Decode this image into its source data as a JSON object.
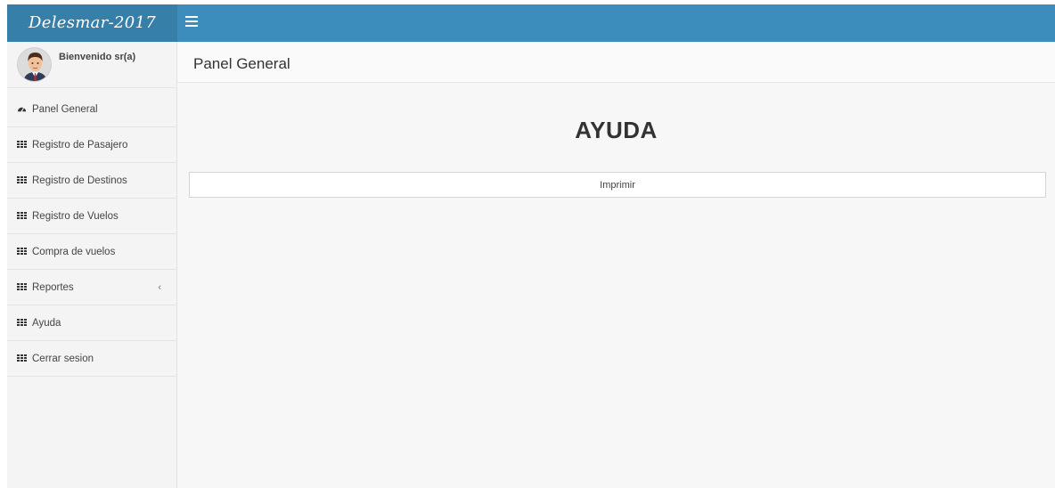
{
  "app": {
    "logo_text": "Delesmar-2017"
  },
  "colors": {
    "logo_bg": "#367fa9",
    "topbar_bg": "#3c8dbc",
    "sidebar_bg": "#f4f4f4",
    "content_bg": "#f7f7f7"
  },
  "user": {
    "greeting": "Bienvenido sr(a)",
    "avatar_icon": "user-avatar-icon"
  },
  "sidebar": {
    "items": [
      {
        "label": "Panel General",
        "icon": "dashboard-icon"
      },
      {
        "label": "Registro de Pasajero",
        "icon": "table-icon"
      },
      {
        "label": "Registro de Destinos",
        "icon": "table-icon"
      },
      {
        "label": "Registro de Vuelos",
        "icon": "table-icon"
      },
      {
        "label": "Compra de vuelos",
        "icon": "table-icon"
      },
      {
        "label": "Reportes",
        "icon": "table-icon",
        "expand_icon": "chevron-left-icon"
      },
      {
        "label": "Ayuda",
        "icon": "table-icon"
      },
      {
        "label": "Cerrar sesion",
        "icon": "table-icon"
      }
    ]
  },
  "header": {
    "title": "Panel General"
  },
  "main": {
    "heading": "AYUDA",
    "print_button": "Imprimir"
  }
}
